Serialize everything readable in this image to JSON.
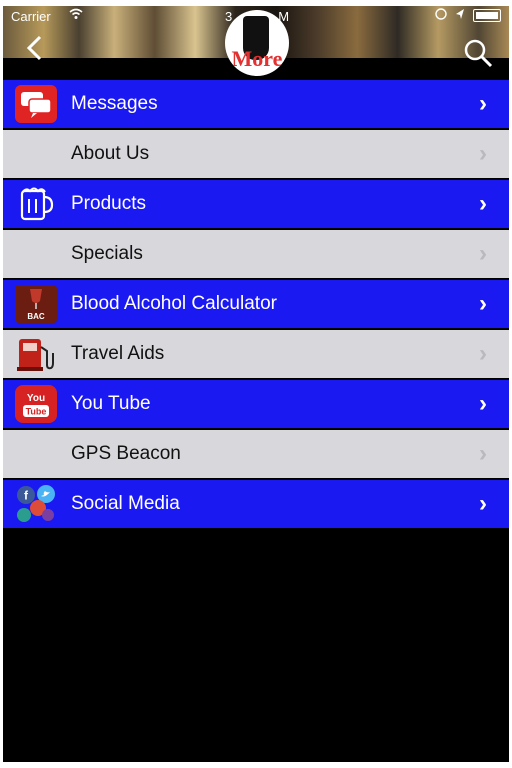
{
  "status_bar": {
    "carrier": "Carrier",
    "time": "3",
    "time_suffix": "M"
  },
  "header": {
    "logo_text": "More"
  },
  "menu": {
    "items": [
      {
        "label": "Messages",
        "style": "blue",
        "icon": "messages-icon"
      },
      {
        "label": "About Us",
        "style": "gray",
        "icon": ""
      },
      {
        "label": "Products",
        "style": "blue",
        "icon": "beer-mug-icon"
      },
      {
        "label": "Specials",
        "style": "gray",
        "icon": ""
      },
      {
        "label": "Blood Alcohol Calculator",
        "style": "blue",
        "icon": "bac-wine-glass-icon",
        "icon_text": "BAC"
      },
      {
        "label": "Travel Aids",
        "style": "gray",
        "icon": "gas-pump-icon"
      },
      {
        "label": "You Tube",
        "style": "blue",
        "icon": "youtube-icon",
        "icon_text": "You Tube"
      },
      {
        "label": "GPS Beacon",
        "style": "gray",
        "icon": ""
      },
      {
        "label": "Social Media",
        "style": "blue",
        "icon": "social-media-icon"
      }
    ]
  },
  "colors": {
    "row_blue": "#1a19f2",
    "row_gray": "#d8d8dc",
    "background": "#000000"
  }
}
